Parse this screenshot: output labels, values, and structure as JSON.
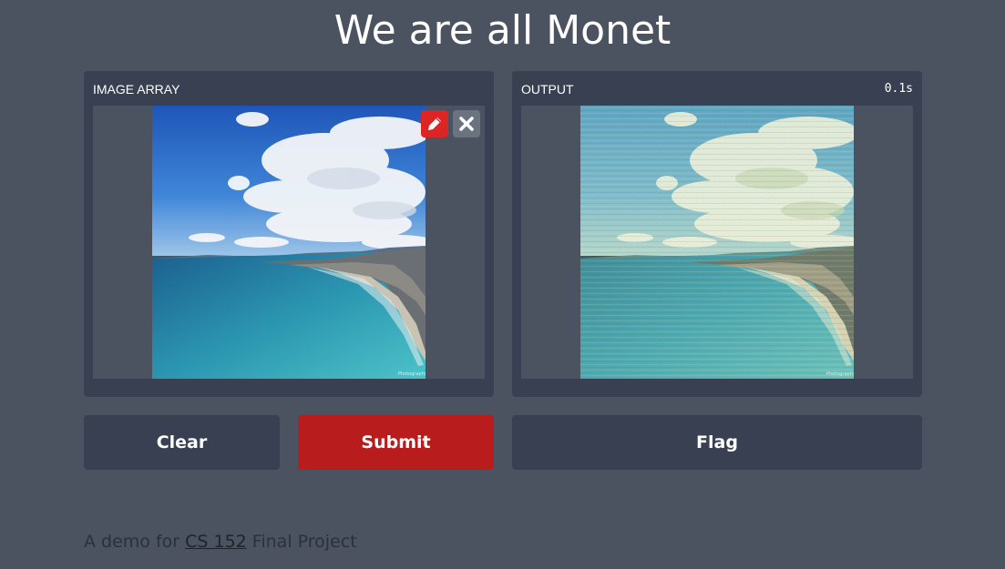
{
  "page": {
    "title": "We are all Monet"
  },
  "input_panel": {
    "label": "IMAGE ARRAY",
    "image": "coastal-city-bay-photo",
    "tools": [
      {
        "icon": "pencil-icon",
        "color": "#dc2626"
      },
      {
        "icon": "close-icon",
        "color": "#6b7280"
      }
    ]
  },
  "output_panel": {
    "label": "OUTPUT",
    "time": "0.1s",
    "image": "monet-style-bay-painting"
  },
  "buttons": {
    "clear": "Clear",
    "submit": "Submit",
    "flag": "Flag"
  },
  "footer": {
    "prefix": "A demo for ",
    "link": "CS 152",
    "suffix": " Final Project"
  },
  "colors": {
    "background": "#4b5260",
    "panel": "#394051",
    "submit": "#b91c1c",
    "edit_button": "#dc2626"
  }
}
